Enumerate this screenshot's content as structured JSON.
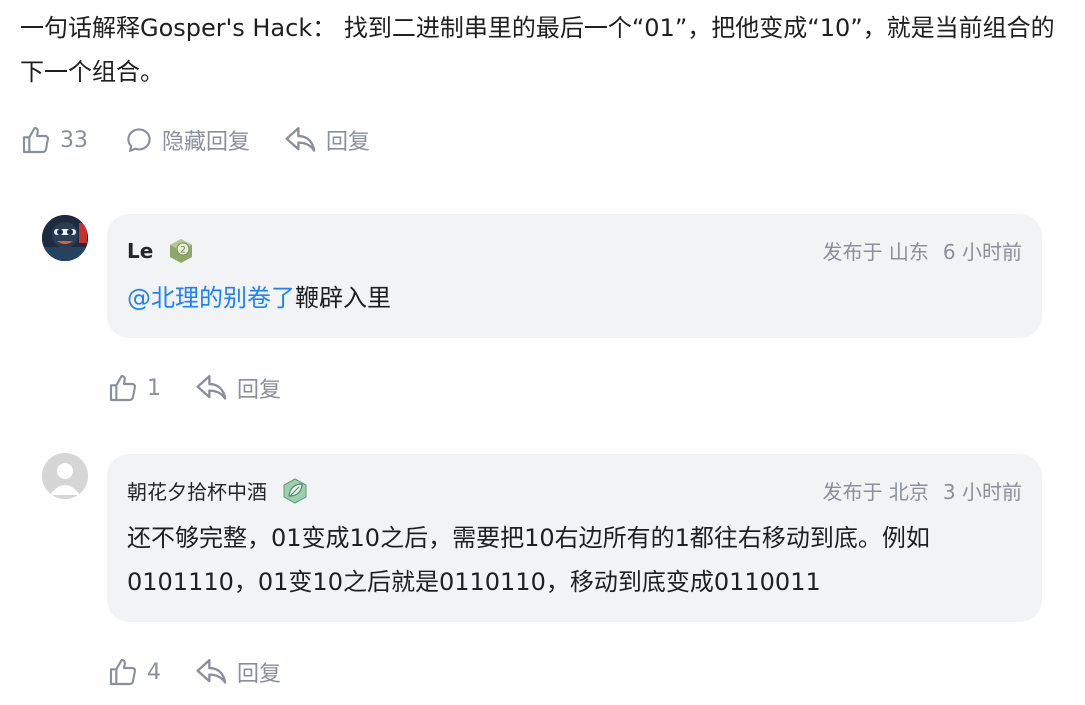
{
  "top_comment": {
    "text": "一句话解释Gosper's Hack： 找到二进制串里的最后一个“01”，把他变成“10”，就是当前组合的下一个组合。",
    "like_count": "33",
    "hide_replies_label": "隐藏回复",
    "reply_label": "回复"
  },
  "replies": [
    {
      "username": "Le",
      "badge_level": "2",
      "location": "发布于 山东",
      "time": "6 小时前",
      "mention": "@北理的别卷了",
      "text": "鞭辟入里",
      "like_count": "1",
      "reply_label": "回复"
    },
    {
      "username": "朝花夕拾杯中酒",
      "location": "发布于 北京",
      "time": "3 小时前",
      "text": "还不够完整，01变成10之后，需要把10右边所有的1都往右移动到底。例如0101110，01变10之后就是0110110，移动到底变成0110011",
      "like_count": "4",
      "reply_label": "回复"
    }
  ],
  "colors": {
    "link": "#1e80ff",
    "muted": "#8a8f99",
    "bubble_bg": "#f2f3f5"
  },
  "icons": [
    "thumb-up-icon",
    "comment-icon",
    "reply-arrow-icon",
    "level-badge-icon",
    "leaf-badge-icon"
  ]
}
